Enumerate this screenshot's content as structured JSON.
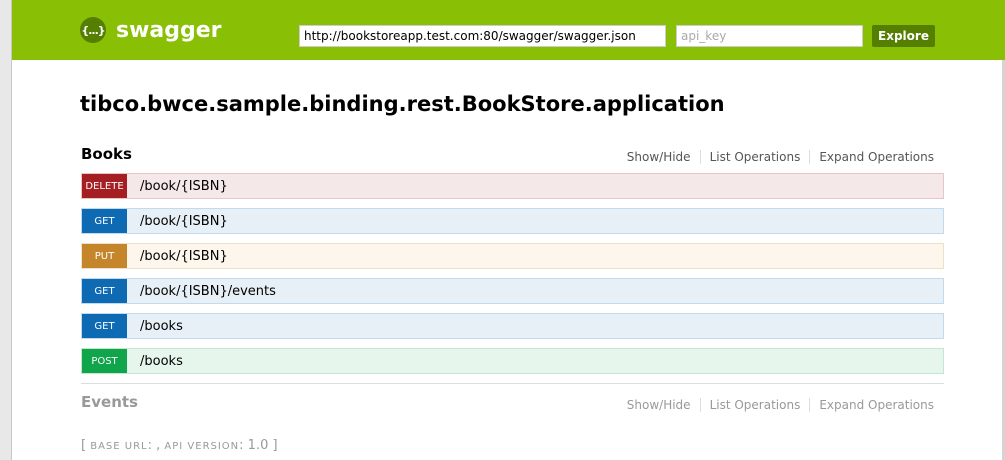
{
  "header": {
    "logo_text": "swagger",
    "logo_badge": "{...}",
    "url_value": "http://bookstoreapp.test.com:80/swagger/swagger.json",
    "api_key_placeholder": "api_key",
    "explore_label": "Explore",
    "background_color": "#89bf04"
  },
  "title": "tibco.bwce.sample.binding.rest.BookStore.application",
  "resources": [
    {
      "name": "Books",
      "links": [
        "Show/Hide",
        "List Operations",
        "Expand Operations"
      ],
      "operations": [
        {
          "method": "DELETE",
          "path": "/book/{ISBN}"
        },
        {
          "method": "GET",
          "path": "/book/{ISBN}"
        },
        {
          "method": "PUT",
          "path": "/book/{ISBN}"
        },
        {
          "method": "GET",
          "path": "/book/{ISBN}/events"
        },
        {
          "method": "GET",
          "path": "/books"
        },
        {
          "method": "POST",
          "path": "/books"
        }
      ]
    },
    {
      "name": "Events",
      "links": [
        "Show/Hide",
        "List Operations",
        "Expand Operations"
      ]
    }
  ],
  "method_colors": {
    "DELETE": "#a41e22",
    "GET": "#0f6ab4",
    "PUT": "#c5862b",
    "POST": "#10a54a"
  },
  "footer": {
    "open_bracket": "[",
    "base_url_label": "BASE URL",
    "base_url_value": ": ,",
    "api_version_label": "API VERSION",
    "api_version_value": ": 1.0",
    "close_bracket": "]"
  }
}
